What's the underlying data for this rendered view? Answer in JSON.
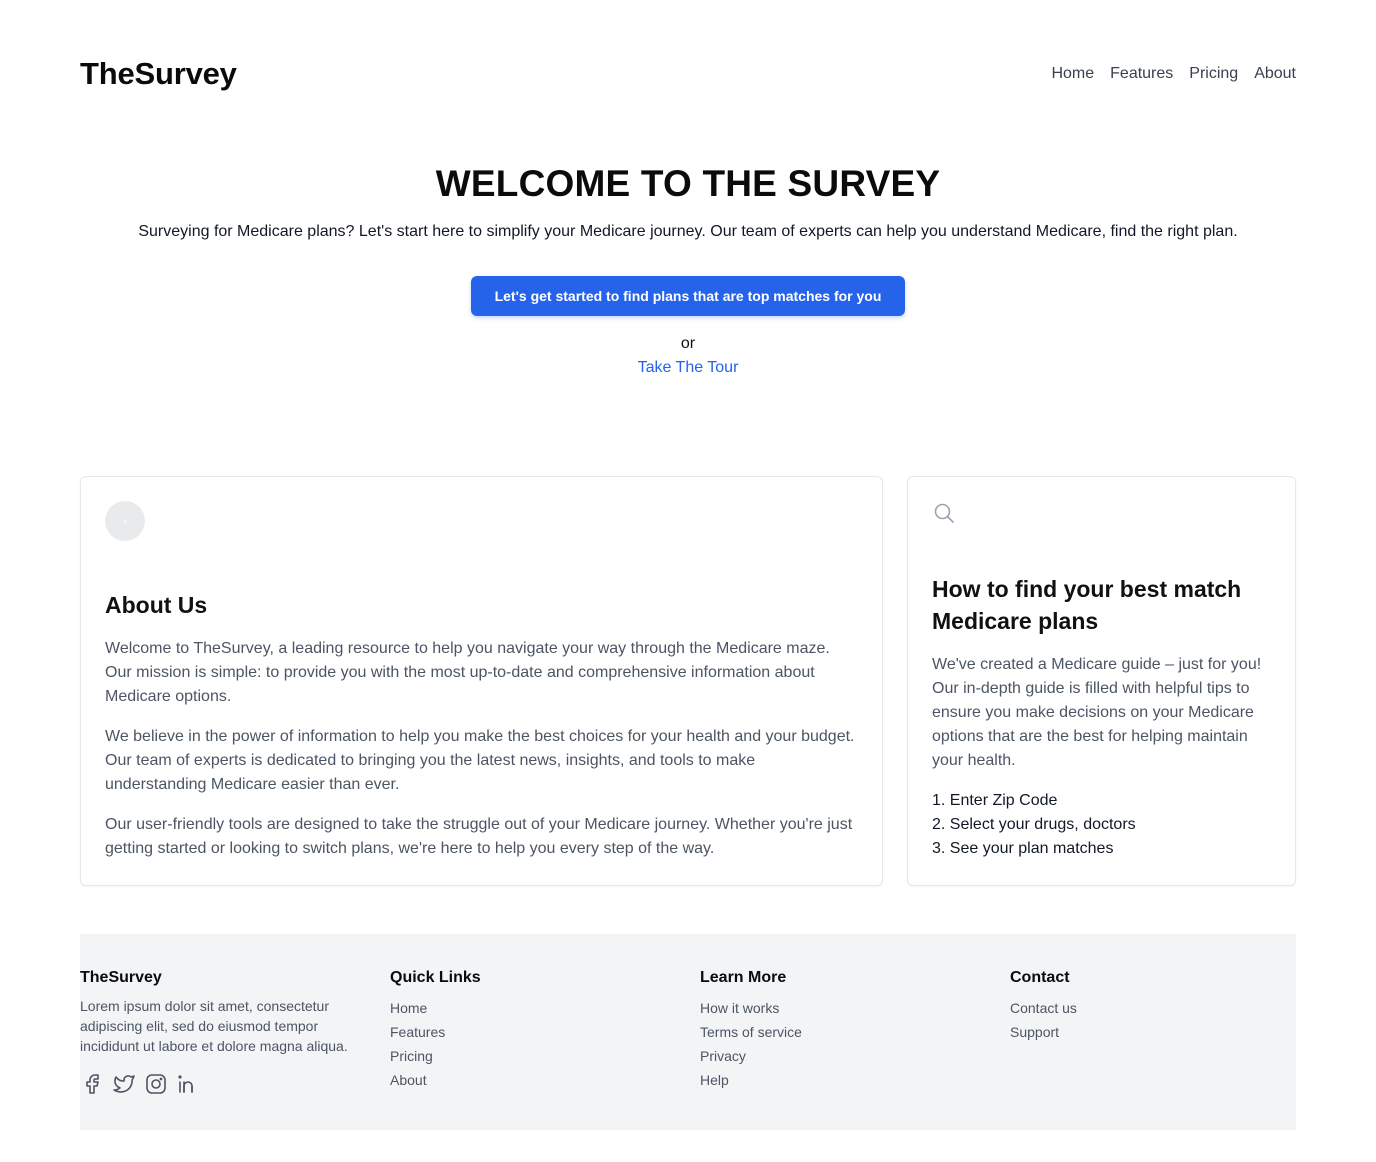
{
  "header": {
    "logo": "TheSurvey",
    "nav": [
      "Home",
      "Features",
      "Pricing",
      "About"
    ]
  },
  "hero": {
    "title": "WELCOME TO THE SURVEY",
    "subtitle": "Surveying for Medicare plans? Let's start here to simplify your Medicare journey. Our team of experts can help you understand Medicare, find the right plan.",
    "cta_label": "Let's get started to find plans that are top matches for you",
    "or_text": "or",
    "tour_link": "Take The Tour"
  },
  "about": {
    "icon": "avatar-placeholder-icon",
    "title": "About Us",
    "paragraphs": [
      "Welcome to TheSurvey, a leading resource to help you navigate your way through the Medicare maze. Our mission is simple: to provide you with the most up-to-date and comprehensive information about Medicare options.",
      "We believe in the power of information to help you make the best choices for your health and your budget. Our team of experts is dedicated to bringing you the latest news, insights, and tools to make understanding Medicare easier than ever.",
      "Our user-friendly tools are designed to take the struggle out of your Medicare journey. Whether you're just getting started or looking to switch plans, we're here to help you every step of the way."
    ]
  },
  "how": {
    "icon": "search-icon",
    "title": "How to find your best match Medicare plans",
    "paragraph": "We've created a Medicare guide – just for you! Our in-depth guide is filled with helpful tips to ensure you make decisions on your Medicare options that are the best for helping maintain your health.",
    "steps": [
      "1. Enter Zip Code",
      "2. Select your drugs, doctors",
      "3. See your plan matches"
    ]
  },
  "footer": {
    "brand": {
      "title": "TheSurvey",
      "description": "Lorem ipsum dolor sit amet, consectetur adipiscing elit, sed do eiusmod tempor incididunt ut labore et dolore magna aliqua.",
      "socials": [
        "facebook-icon",
        "twitter-icon",
        "instagram-icon",
        "linkedin-icon"
      ]
    },
    "quick_links": {
      "title": "Quick Links",
      "items": [
        "Home",
        "Features",
        "Pricing",
        "About"
      ]
    },
    "learn_more": {
      "title": "Learn More",
      "items": [
        "How it works",
        "Terms of service",
        "Privacy",
        "Help"
      ]
    },
    "contact": {
      "title": "Contact",
      "items": [
        "Contact us",
        "Support"
      ]
    }
  },
  "colors": {
    "accent": "#2563eb",
    "footer_bg": "#f3f4f6",
    "body_text": "#4b5563",
    "border": "#e5e7eb"
  }
}
